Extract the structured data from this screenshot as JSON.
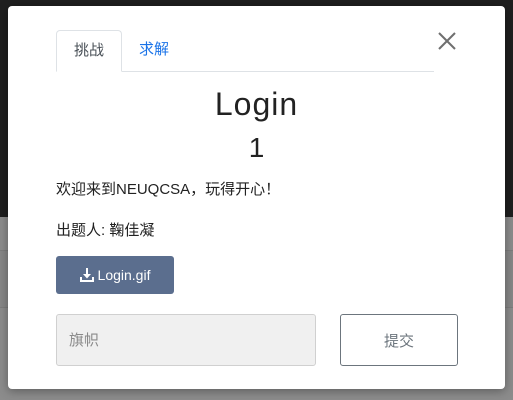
{
  "tabs": [
    {
      "label": "挑战",
      "active": true
    },
    {
      "label": "求解",
      "active": false
    }
  ],
  "challenge": {
    "name": "Login",
    "value": "1",
    "description": "欢迎来到NEUQCSA，玩得开心！",
    "author": "出题人: 鞠佳凝",
    "file_label": "Login.gif"
  },
  "form": {
    "flag_placeholder": "旗帜",
    "flag_value": "",
    "submit_label": "提交"
  },
  "icons": {
    "close": "close-icon",
    "download": "download-icon"
  },
  "colors": {
    "accent": "#1a73e8",
    "file_button": "#5b6e8e",
    "submit_border": "#6c757d"
  }
}
